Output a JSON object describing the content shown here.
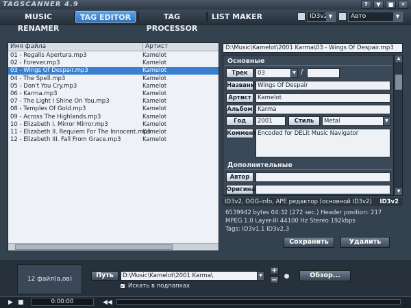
{
  "app": {
    "title": "TAGSCANNER 4.9"
  },
  "window_buttons": [
    "?",
    "▼",
    "■",
    "✕"
  ],
  "tabs": [
    {
      "label": "MUSIC RENAMER",
      "active": false
    },
    {
      "label": "TAG EDITOR",
      "active": true
    },
    {
      "label": "TAG PROCESSOR",
      "active": false
    },
    {
      "label": "LIST MAKER",
      "active": false
    }
  ],
  "toolbar": {
    "tag_version": "ID3v2",
    "mode": "Авто",
    "folder_icon": "folder-icon",
    "save_icon": "floppy-icon"
  },
  "file_list": {
    "columns": [
      "Имя файла",
      "Артист"
    ],
    "rows": [
      {
        "name": "01 - Regalis Apertura.mp3",
        "artist": "Kamelot"
      },
      {
        "name": "02 - Forever.mp3",
        "artist": "Kamelot"
      },
      {
        "name": "03 - Wings Of Despair.mp3",
        "artist": "Kamelot"
      },
      {
        "name": "04 - The Spell.mp3",
        "artist": "Kamelot"
      },
      {
        "name": "05 - Don't You Cry.mp3",
        "artist": "Kamelot"
      },
      {
        "name": "06 - Karma.mp3",
        "artist": "Kamelot"
      },
      {
        "name": "07 - The Light I Shine On You.mp3",
        "artist": "Kamelot"
      },
      {
        "name": "08 - Temples Of Gold.mp3",
        "artist": "Kamelot"
      },
      {
        "name": "09 - Across The Highlands.mp3",
        "artist": "Kamelot"
      },
      {
        "name": "10 - Elizabeth  I. Mirror Mirror.mp3",
        "artist": "Kamelot"
      },
      {
        "name": "11 - Elizabeth  II. Requiem For The Innocent.mp3",
        "artist": "Kamelot"
      },
      {
        "name": "12 - Elizabeth  III. Fall From Grace.mp3",
        "artist": "Kamelot"
      }
    ],
    "selected_index": 2
  },
  "editor": {
    "file_path": "D:\\Music\\Kamelot\\2001 Karma\\03 - Wings Of Despair.mp3",
    "section_main": "Основные",
    "section_extra": "Дополнительные",
    "labels": {
      "track": "Трек",
      "title": "Название",
      "artist": "Артист",
      "album": "Альбом",
      "year": "Год",
      "genre": "Стиль",
      "comment": "Коммент",
      "author": "Автор",
      "original": "Оригинал"
    },
    "values": {
      "track": "03",
      "track_sep": "/",
      "track_total": "",
      "title": "Wings Of Despair",
      "artist": "Kamelot",
      "album": "Karma",
      "year": "2001",
      "genre": "Metal",
      "comment": "Encoded for DELit Music Navigator",
      "author": "",
      "original": ""
    }
  },
  "tag_info": {
    "bar": "ID3v2, OGG-info, APE редактор (основной ID3v2)",
    "type": "ID3v2",
    "line1": "6539942 bytes  04:32 (272 sec.)  Header position: 217",
    "line2": "MPEG 1.0  Layer-III  44100 Hz  Stereo  192kbps",
    "line3": "Tags: ID3v1.1 ID3v2.3"
  },
  "actions": {
    "save": "Сохранить",
    "delete": "Удалить"
  },
  "bottom": {
    "file_count": "12 файл(а,ов)",
    "path_label": "Путь",
    "path_value": "D:\\Music\\Kamelot\\2001 Karma\\",
    "browse": "Обзор...",
    "plus": "+",
    "minus": "−",
    "subfolders_label": "Искать в подпапках",
    "subfolders_checked": true,
    "check_mark": "✓"
  },
  "player": {
    "time": "0:00:00"
  }
}
